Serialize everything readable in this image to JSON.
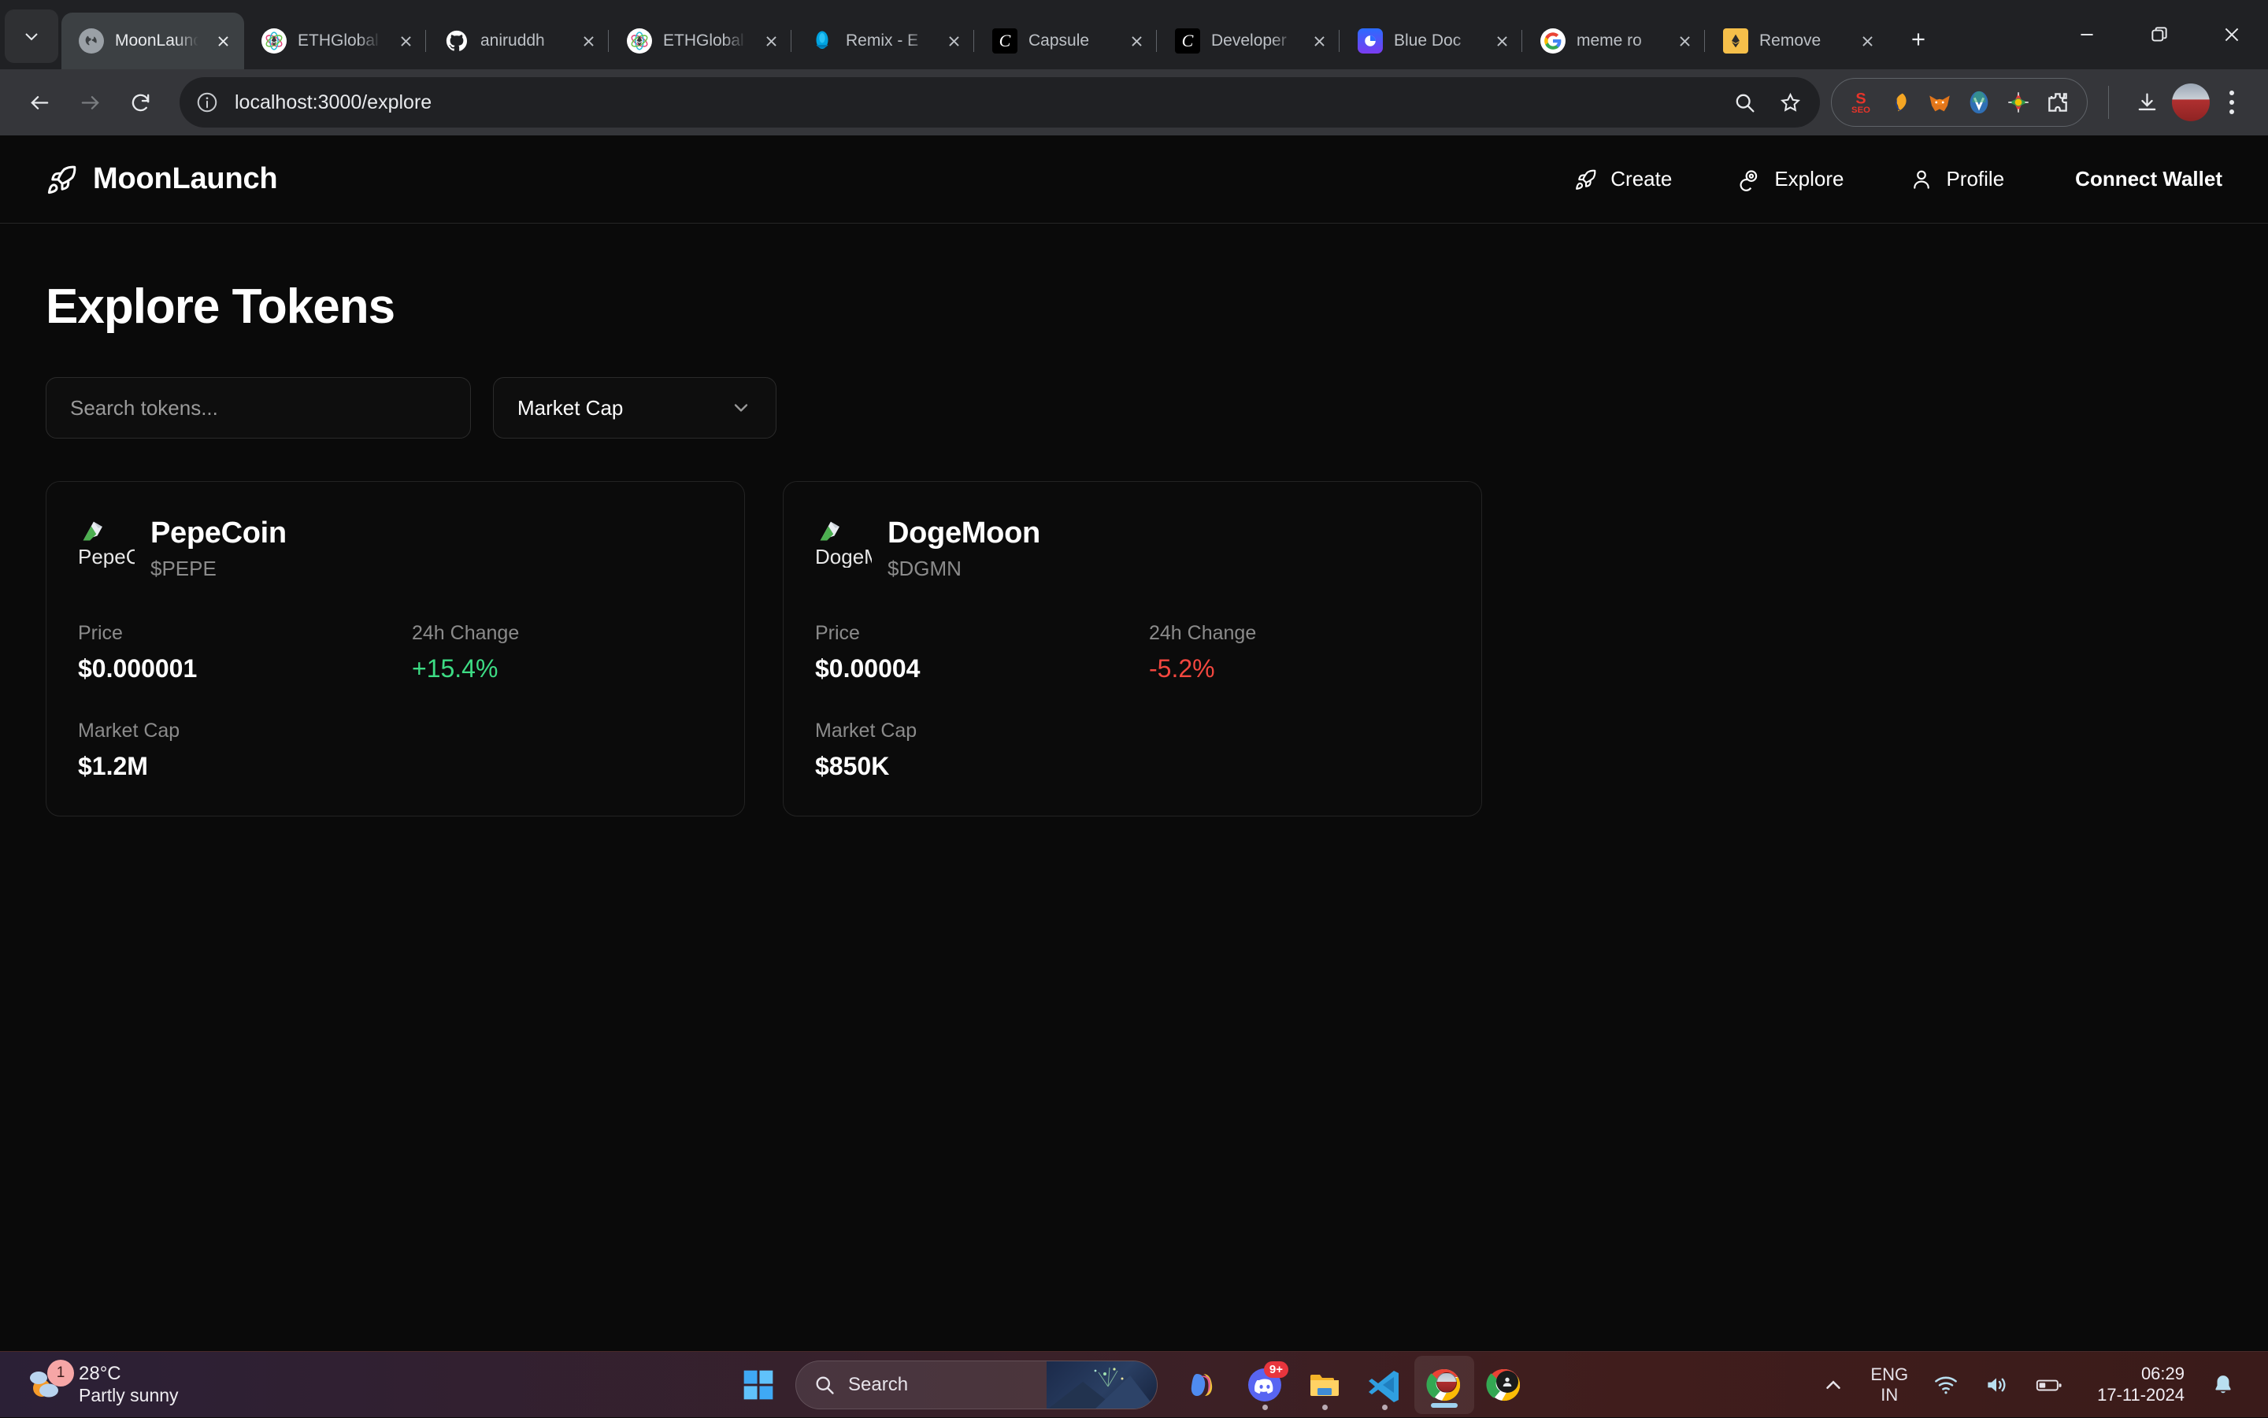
{
  "browser": {
    "tab_list_chevron_icon": "chevron-down-icon",
    "tabs": [
      {
        "title": "MoonLaunch",
        "favicon": "globe-icon",
        "active": true
      },
      {
        "title": "ETHGlobal",
        "favicon": "ethglobal-icon",
        "active": false
      },
      {
        "title": "aniruddh",
        "favicon": "github-icon",
        "active": false
      },
      {
        "title": "ETHGlobal",
        "favicon": "ethglobal-icon",
        "active": false
      },
      {
        "title": "Remix - E",
        "favicon": "remix-icon",
        "active": false
      },
      {
        "title": "Capsule",
        "favicon": "capsule-icon",
        "active": false
      },
      {
        "title": "Developer",
        "favicon": "capsule-icon",
        "active": false
      },
      {
        "title": "Blue Doc",
        "favicon": "bluedoc-icon",
        "active": false
      },
      {
        "title": "meme ro",
        "favicon": "google-icon",
        "active": false
      },
      {
        "title": "Remove",
        "favicon": "ethereum-icon",
        "active": false
      }
    ],
    "new_tab_label": "+",
    "window_controls": {
      "minimize": "minimize-icon",
      "restore": "restore-icon",
      "close": "close-icon"
    },
    "toolbar": {
      "back_icon": "back-arrow-icon",
      "forward_icon": "forward-arrow-icon",
      "reload_icon": "reload-icon",
      "site_info_icon": "info-circle-icon",
      "url": "localhost:3000/explore",
      "zoom_icon": "search-icon",
      "bookmark_icon": "star-icon",
      "extensions": [
        "seo-extension-icon",
        "honey-extension-icon",
        "metamask-extension-icon",
        "vimium-extension-icon",
        "colorpicker-extension-icon",
        "extensions-puzzle-icon"
      ],
      "download_icon": "download-icon",
      "profile_icon": "avatar",
      "menu_icon": "kebab-menu-icon"
    }
  },
  "app": {
    "navbar": {
      "logo_icon": "rocket-icon",
      "brand": "MoonLaunch",
      "links": [
        {
          "label": "Create",
          "icon": "rocket-icon"
        },
        {
          "label": "Explore",
          "icon": "coins-icon"
        },
        {
          "label": "Profile",
          "icon": "user-icon"
        }
      ],
      "connect_wallet": "Connect Wallet"
    },
    "page_title": "Explore Tokens",
    "filters": {
      "search_placeholder": "Search tokens...",
      "search_value": "",
      "sort_selected": "Market Cap",
      "sort_chevron_icon": "chevron-down-icon"
    },
    "labels": {
      "price": "Price",
      "change_24h": "24h Change",
      "market_cap": "Market Cap"
    },
    "colors": {
      "positive": "#3ddc84",
      "negative": "#f4473f",
      "card_bg": "#0b0b0b",
      "card_border": "#232323",
      "page_bg": "#0a0a0a"
    },
    "tokens": [
      {
        "image_alt": "PepeCoin",
        "image_alt_truncated": "PepeC",
        "name": "PepeCoin",
        "symbol": "$PEPE",
        "price": "$0.000001",
        "change_24h": "+15.4%",
        "change_direction": "up",
        "market_cap": "$1.2M"
      },
      {
        "image_alt": "DogeMoon",
        "image_alt_truncated": "DogeM",
        "name": "DogeMoon",
        "symbol": "$DGMN",
        "price": "$0.00004",
        "change_24h": "-5.2%",
        "change_direction": "down",
        "market_cap": "$850K"
      }
    ]
  },
  "taskbar": {
    "weather": {
      "temperature": "28°C",
      "description": "Partly sunny",
      "badge": "1",
      "icon": "partly-sunny-icon"
    },
    "start_icon": "windows-start-icon",
    "search": {
      "placeholder": "Search",
      "icon": "search-icon"
    },
    "apps": [
      {
        "name": "copilot",
        "icon": "copilot-icon",
        "running": false,
        "badge": ""
      },
      {
        "name": "discord",
        "icon": "discord-icon",
        "running": true,
        "badge": "9+"
      },
      {
        "name": "file-explorer",
        "icon": "folder-icon",
        "running": true,
        "badge": ""
      },
      {
        "name": "vs-code",
        "icon": "vscode-icon",
        "running": true,
        "badge": ""
      },
      {
        "name": "chrome",
        "icon": "chrome-icon",
        "running": true,
        "badge": "",
        "active": true
      },
      {
        "name": "chrome-canary",
        "icon": "chrome-canary-icon",
        "running": false,
        "badge": ""
      }
    ],
    "tray": {
      "overflow_icon": "chevron-up-icon",
      "language_line1": "ENG",
      "language_line2": "IN",
      "wifi_icon": "wifi-icon",
      "volume_icon": "volume-icon",
      "battery_icon": "battery-icon",
      "time": "06:29",
      "date": "17-11-2024",
      "notifications_icon": "bell-icon"
    }
  }
}
